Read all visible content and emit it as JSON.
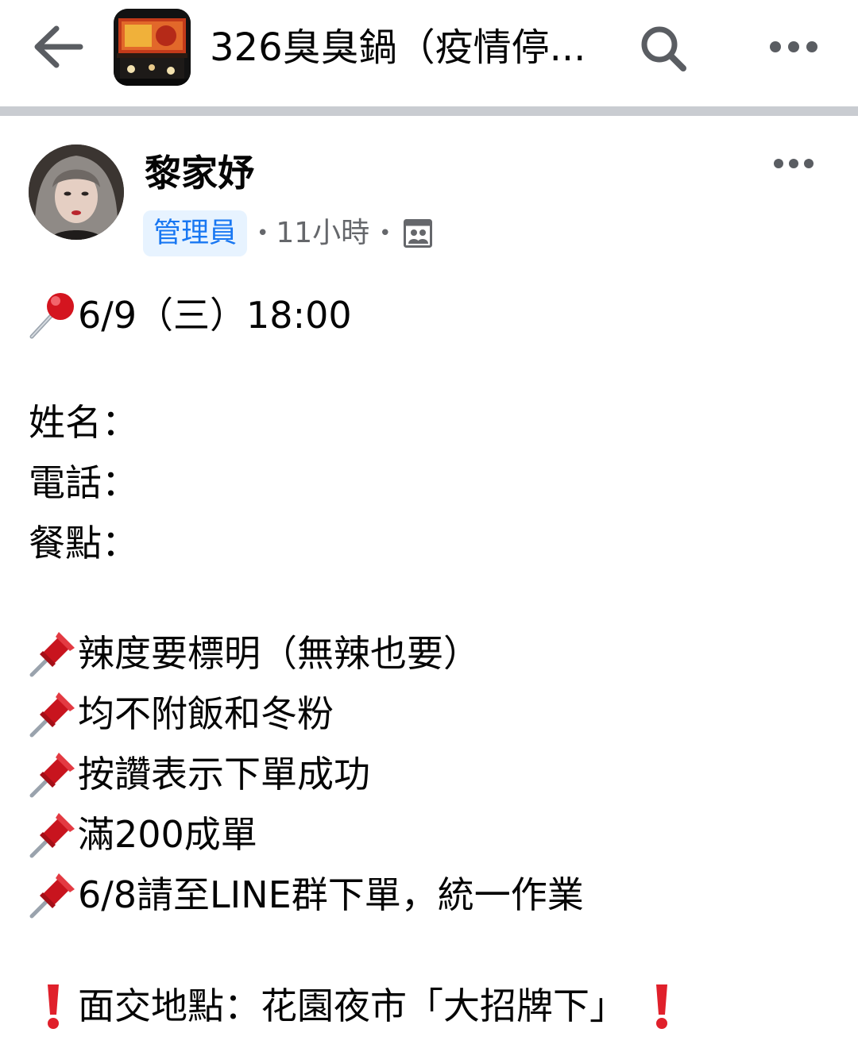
{
  "header": {
    "page_title": "326臭臭鍋（疫情停...",
    "back_icon": "arrow-left-icon",
    "search_icon": "search-icon",
    "more_icon": "more-horizontal-icon"
  },
  "post": {
    "author": "黎家妤",
    "role_badge": "管理員",
    "time": "11小時",
    "audience_icon": "group-members-icon",
    "more_icon": "more-horizontal-icon",
    "date_line": {
      "icon": "round-pushpin-emoji",
      "text": "6/9（三）18:00"
    },
    "form_fields": [
      "姓名：",
      "電話：",
      "餐點："
    ],
    "notes": [
      {
        "icon": "pushpin-emoji",
        "text": "辣度要標明（無辣也要）"
      },
      {
        "icon": "pushpin-emoji",
        "text": "均不附飯和冬粉"
      },
      {
        "icon": "pushpin-emoji",
        "text": "按讚表示下單成功"
      },
      {
        "icon": "pushpin-emoji",
        "text": "滿200成單"
      },
      {
        "icon": "pushpin-emoji",
        "text": "6/8請至LINE群下單，統一作業"
      }
    ],
    "location_line": {
      "icon": "exclamation-mark-emoji",
      "text": "面交地點：花園夜市「大招牌下」"
    }
  },
  "colors": {
    "accent": "#1877f2",
    "badge_bg": "#e7f3ff",
    "secondary_text": "#65676b",
    "divider": "#c9ccd1",
    "pin_red": "#e0202b"
  }
}
